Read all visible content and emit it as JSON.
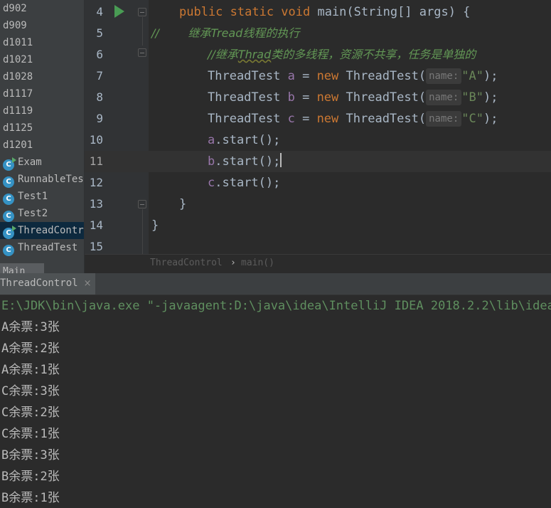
{
  "sidebar": {
    "items": [
      {
        "label": "d902",
        "type": "folder"
      },
      {
        "label": "d909",
        "type": "folder"
      },
      {
        "label": "d1011",
        "type": "folder"
      },
      {
        "label": "d1021",
        "type": "folder"
      },
      {
        "label": "d1028",
        "type": "folder"
      },
      {
        "label": "d1117",
        "type": "folder"
      },
      {
        "label": "d1119",
        "type": "folder"
      },
      {
        "label": "d1125",
        "type": "folder"
      },
      {
        "label": "d1201",
        "type": "folder"
      },
      {
        "label": "Exam",
        "type": "runnable-class",
        "icon": "c"
      },
      {
        "label": "RunnableTest",
        "type": "class",
        "icon": "c"
      },
      {
        "label": "Test1",
        "type": "class",
        "icon": "c"
      },
      {
        "label": "Test2",
        "type": "class",
        "icon": "c"
      },
      {
        "label": "ThreadControl",
        "type": "runnable-class",
        "icon": "c",
        "selected": true
      },
      {
        "label": "ThreadTest",
        "type": "class",
        "icon": "c"
      }
    ],
    "bottom_label": "Main"
  },
  "editor": {
    "line_numbers": [
      "4",
      "5",
      "6",
      "7",
      "8",
      "9",
      "10",
      "11",
      "12",
      "13",
      "14",
      "15"
    ],
    "current_line": "11",
    "lines": {
      "l4": {
        "kw1": "public static void ",
        "name": "main",
        "rest": "(String[] args) {"
      },
      "l5": {
        "prefix": "//",
        "comment": "        继承Tread线程的执行"
      },
      "l6": {
        "comment_a": "//继承",
        "comment_b": "Thrad",
        "comment_c": "类的多线程，资源不共享，任务是单独的"
      },
      "l7": {
        "type": "ThreadTest ",
        "var": "a",
        "eq": " = ",
        "kw": "new",
        "ctor": " ThreadTest(",
        "hint": "name:",
        "str": "\"A\"",
        "end": ");"
      },
      "l8": {
        "type": "ThreadTest ",
        "var": "b",
        "eq": " = ",
        "kw": "new",
        "ctor": " ThreadTest(",
        "hint": "name:",
        "str": "\"B\"",
        "end": ");"
      },
      "l9": {
        "type": "ThreadTest ",
        "var": "c",
        "eq": " = ",
        "kw": "new",
        "ctor": " ThreadTest(",
        "hint": "name:",
        "str": "\"C\"",
        "end": ");"
      },
      "l10": {
        "var": "a",
        "call": ".start();"
      },
      "l11": {
        "var": "b",
        "call": ".start();"
      },
      "l12": {
        "var": "c",
        "call": ".start();"
      },
      "l13": {
        "brace": "}"
      },
      "l14": {
        "brace": "}"
      }
    }
  },
  "breadcrumb": {
    "class": "ThreadControl",
    "separator": "›",
    "method": "main()"
  },
  "run_panel": {
    "tab_label": "ThreadControl",
    "close_glyph": "×",
    "console": [
      "E:\\JDK\\bin\\java.exe \"-javaagent:D:\\java\\idea\\IntelliJ IDEA 2018.2.2\\lib\\idea_rt.jar",
      "A余票:3张",
      "A余票:2张",
      "A余票:1张",
      "C余票:3张",
      "C余票:2张",
      "C余票:1张",
      "B余票:3张",
      "B余票:2张",
      "B余票:1张"
    ]
  },
  "colors": {
    "keyword": "#cc7832",
    "string": "#6a8759",
    "comment": "#629755",
    "field": "#9876aa",
    "text": "#a9b7c6",
    "class_icon": "#3592c4",
    "run_icon": "#499c54"
  }
}
